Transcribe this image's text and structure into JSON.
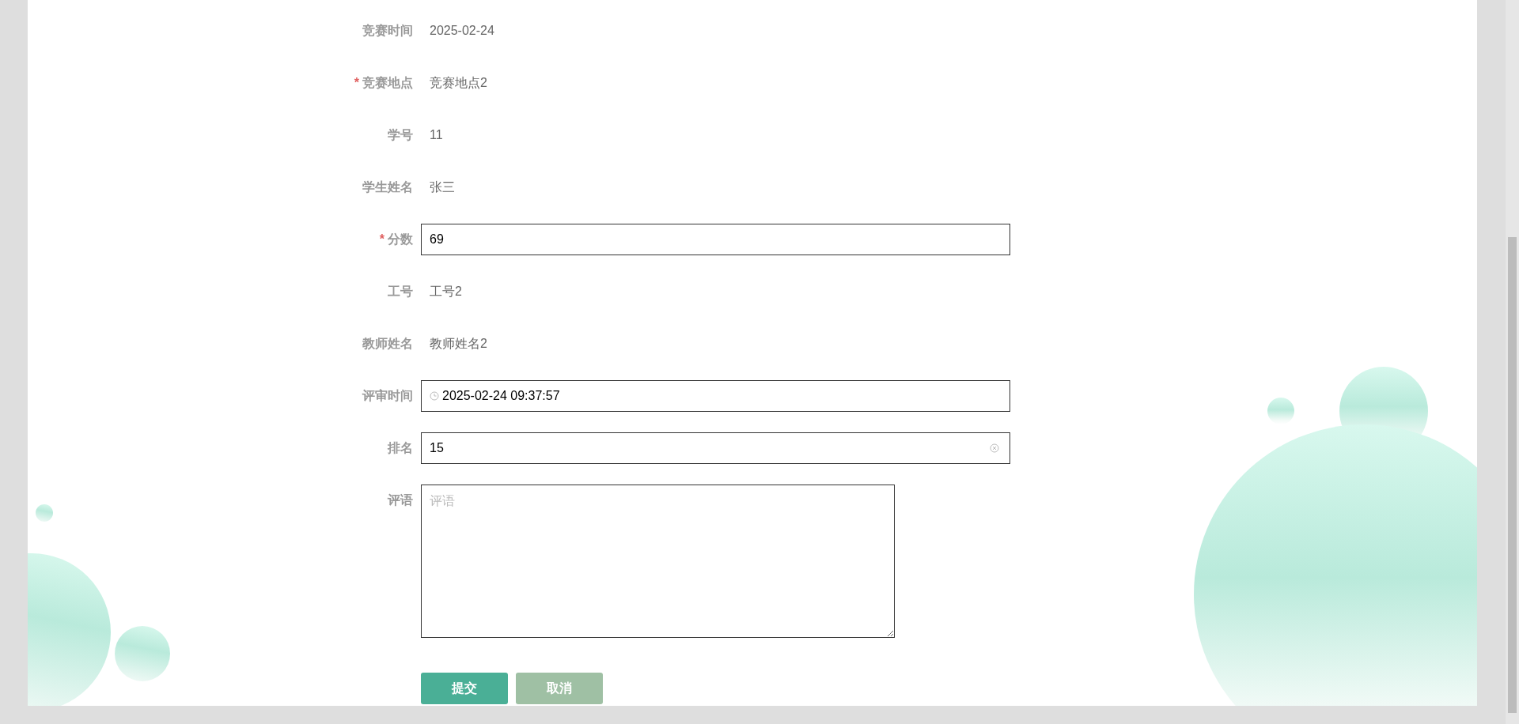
{
  "form": {
    "fields": [
      {
        "kind": "text",
        "label": "竞赛时间",
        "value": "2025-02-24"
      },
      {
        "kind": "text",
        "label": "竞赛地点",
        "required_mark": "*",
        "value": "竞赛地点2"
      },
      {
        "kind": "text",
        "label": "学号",
        "value": "11"
      },
      {
        "kind": "text",
        "label": "学生姓名",
        "value": "张三"
      },
      {
        "kind": "input",
        "label": "分数",
        "required_mark": "*",
        "value": "69"
      },
      {
        "kind": "text",
        "label": "工号",
        "value": "工号2"
      },
      {
        "kind": "text",
        "label": "教师姓名",
        "value": "教师姓名2"
      },
      {
        "kind": "datetime",
        "label": "评审时间",
        "value": "2025-02-24 09:37:57"
      },
      {
        "kind": "input",
        "label": "排名",
        "value": "15",
        "clearable": true
      },
      {
        "kind": "textarea",
        "label": "评语",
        "placeholder": "评语"
      }
    ],
    "buttons": [
      {
        "kind": "primary",
        "label": "提交"
      },
      {
        "kind": "secondary",
        "label": "取消"
      }
    ]
  }
}
